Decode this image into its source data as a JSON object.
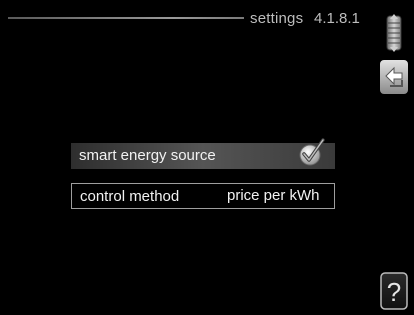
{
  "header": {
    "title": "settings",
    "menu_number": "4.1.8.1"
  },
  "menu": {
    "smart_energy_source": {
      "label": "smart energy source",
      "checked": true
    },
    "control_method": {
      "label": "control method",
      "value": "price per kWh"
    }
  },
  "icons": {
    "scroll": "scroll-wheel-icon",
    "back": "back-arrow-icon",
    "help": "help-icon",
    "check": "checkmark-icon"
  },
  "help": {
    "symbol": "?"
  }
}
